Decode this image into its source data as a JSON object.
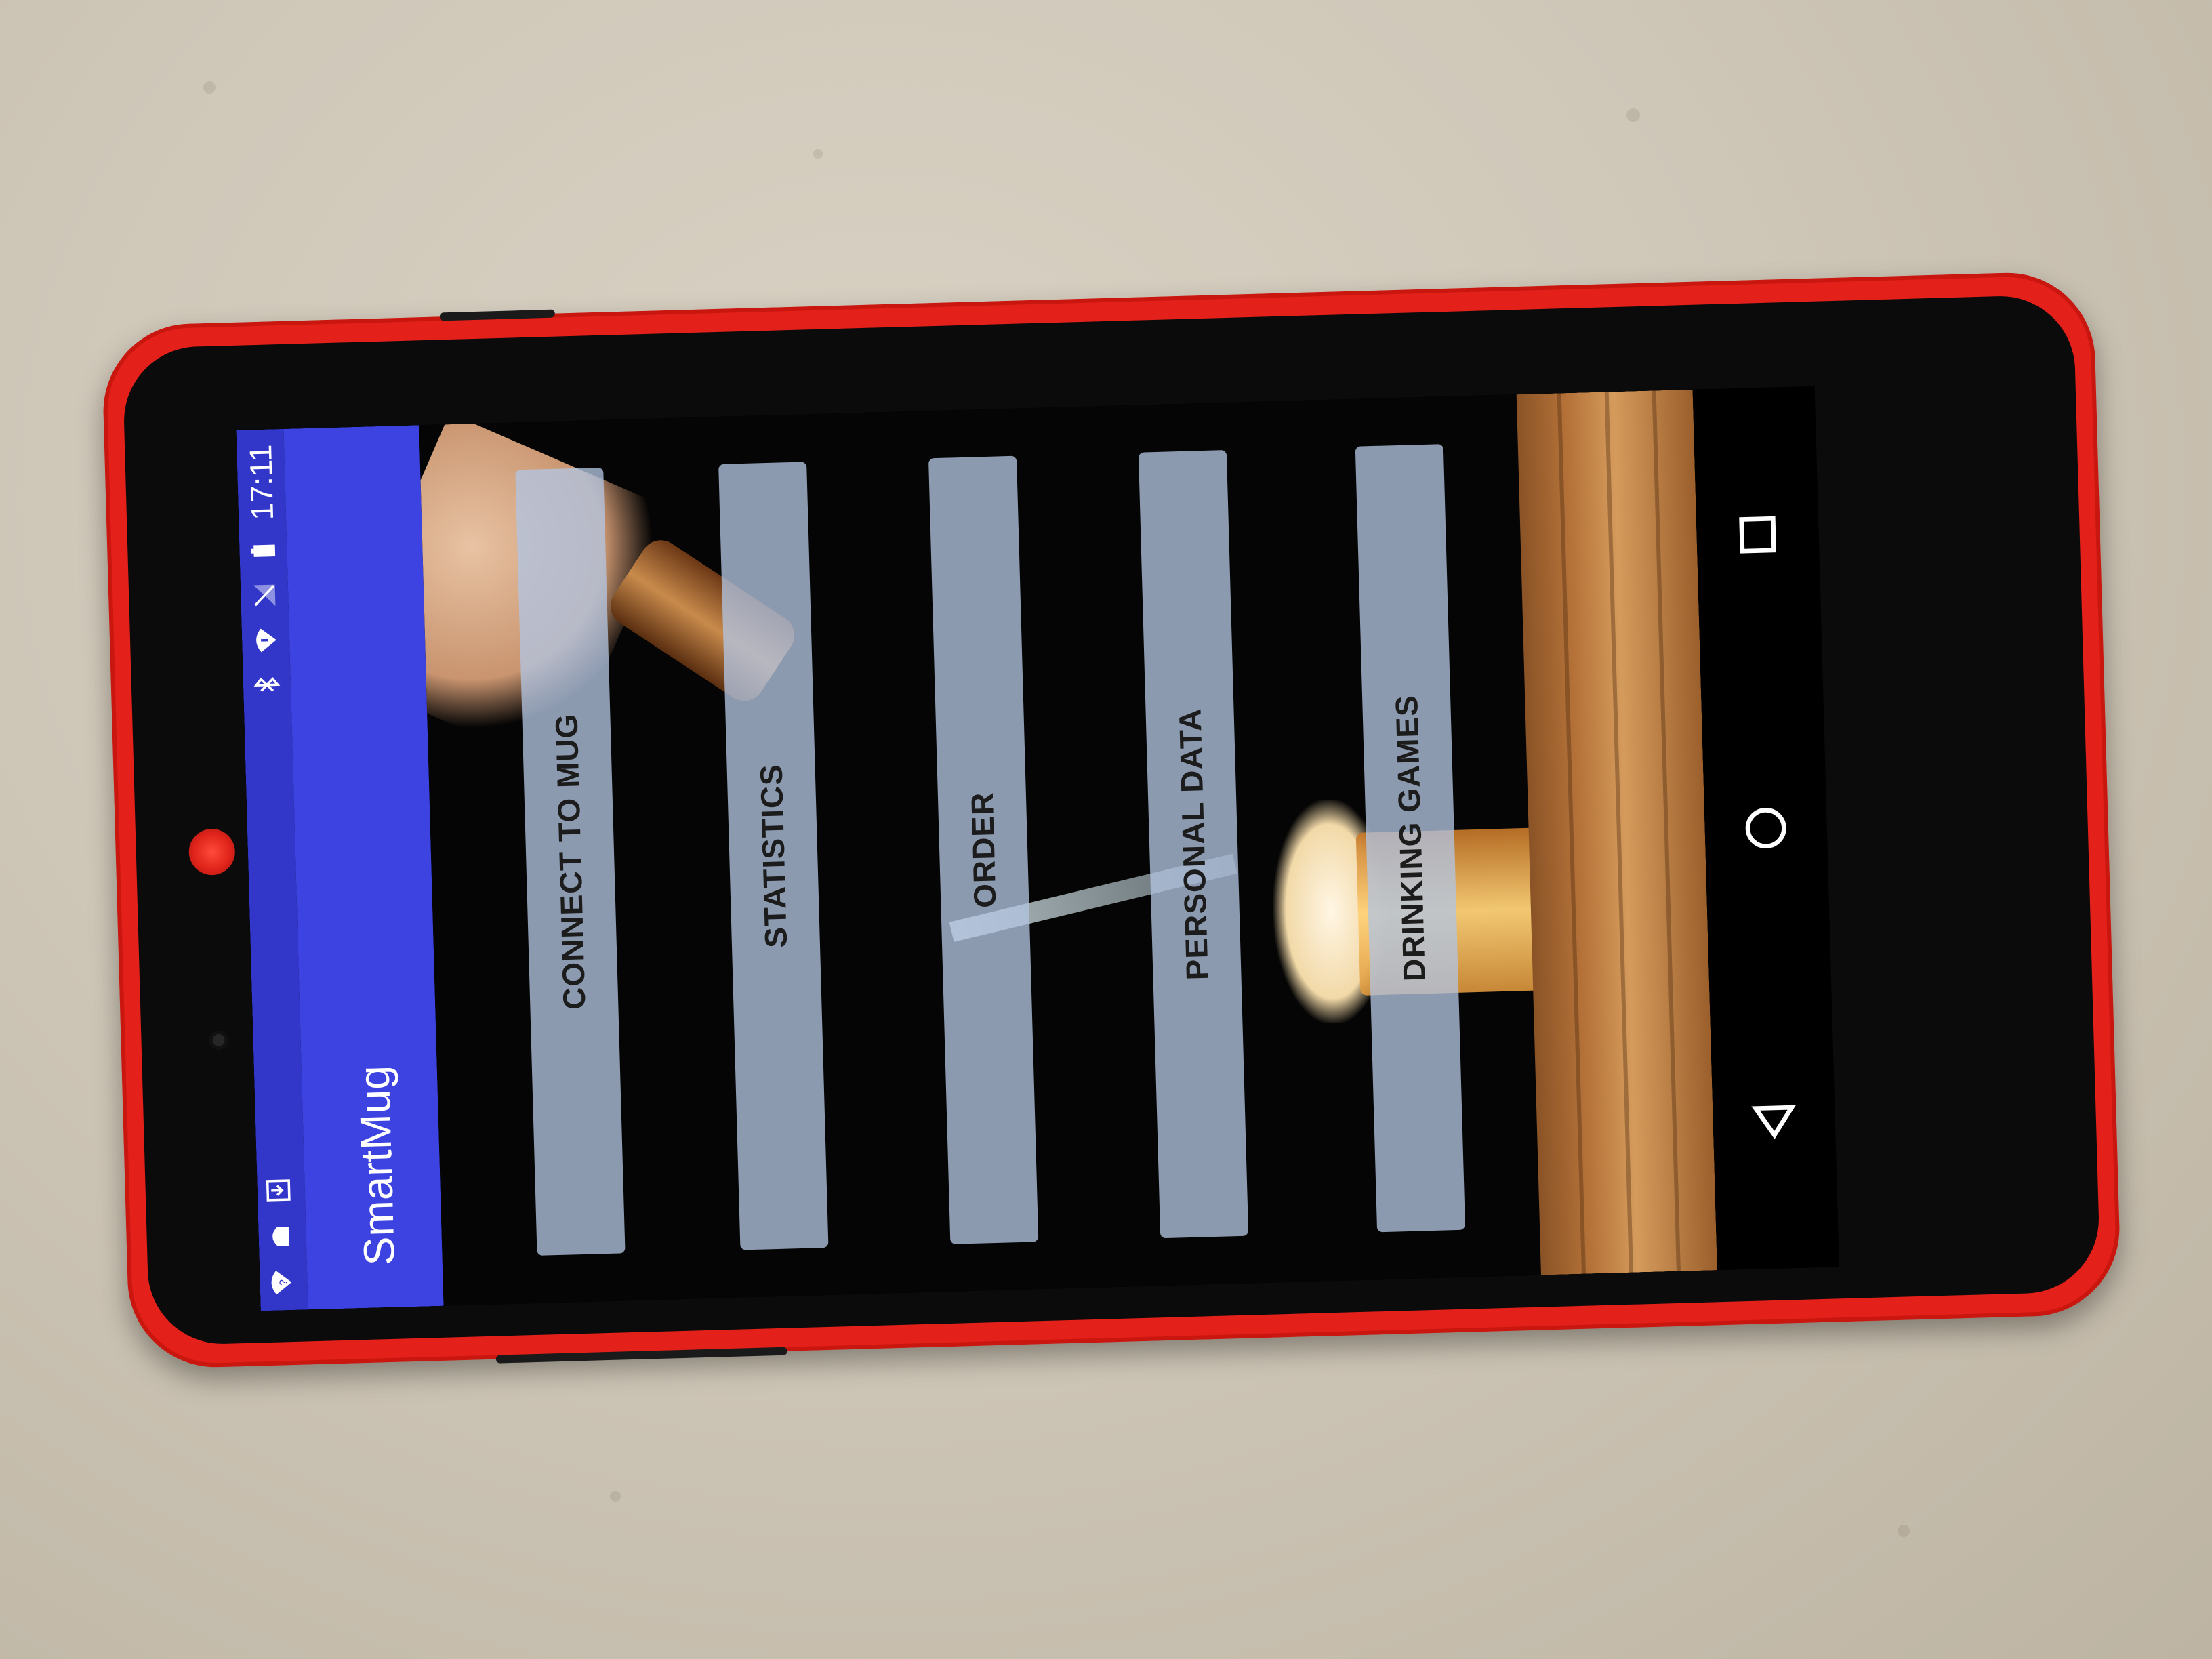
{
  "status_bar": {
    "time": "17:11",
    "left_icons": [
      "wifi-unknown-icon",
      "android-icon",
      "download-icon"
    ],
    "right_icons": [
      "bluetooth-icon",
      "wifi-alert-icon",
      "no-signal-icon",
      "battery-icon"
    ]
  },
  "app_bar": {
    "title": "SmartMug"
  },
  "menu": {
    "buttons": [
      {
        "label": "CONNECT TO MUG"
      },
      {
        "label": "STATISTICS"
      },
      {
        "label": "ORDER"
      },
      {
        "label": "PERSONAL DATA"
      },
      {
        "label": "DRINKING GAMES"
      }
    ]
  },
  "nav_bar": {
    "buttons": [
      "back-icon",
      "home-icon",
      "recents-icon"
    ]
  },
  "colors": {
    "status_bar": "#3237c9",
    "app_bar": "#3d43e0",
    "button_fill": "#b2c4e0",
    "phone_body": "#e3201a"
  }
}
